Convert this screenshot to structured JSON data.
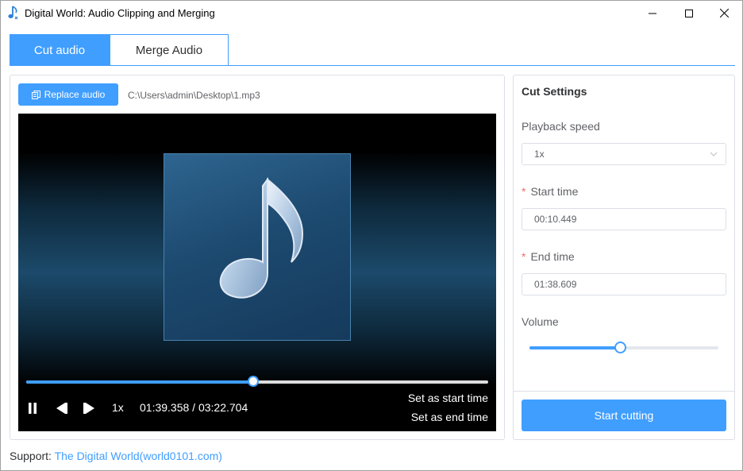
{
  "window": {
    "title": "Digital World: Audio Clipping and Merging"
  },
  "tabs": [
    {
      "label": "Cut audio",
      "active": true
    },
    {
      "label": "Merge Audio",
      "active": false
    }
  ],
  "left": {
    "replace_label": "Replace audio",
    "file_path": "C:\\Users\\admin\\Desktop\\1.mp3",
    "player": {
      "progress": 0.491,
      "speed": "1x",
      "time": "01:39.358 / 03:22.704",
      "set_start_label": "Set as start time",
      "set_end_label": "Set as end time"
    }
  },
  "settings": {
    "title": "Cut Settings",
    "speed_label": "Playback speed",
    "speed_value": "1x",
    "start_label": "Start time",
    "start_value": "00:10.449",
    "end_label": "End time",
    "end_value": "01:38.609",
    "volume_label": "Volume",
    "volume": 0.48,
    "start_btn": "Start cutting"
  },
  "footer": {
    "support_label": "Support: ",
    "support_link": "The Digital World(world0101.com)"
  },
  "colors": {
    "accent": "#409eff",
    "required": "#f56c6c"
  }
}
